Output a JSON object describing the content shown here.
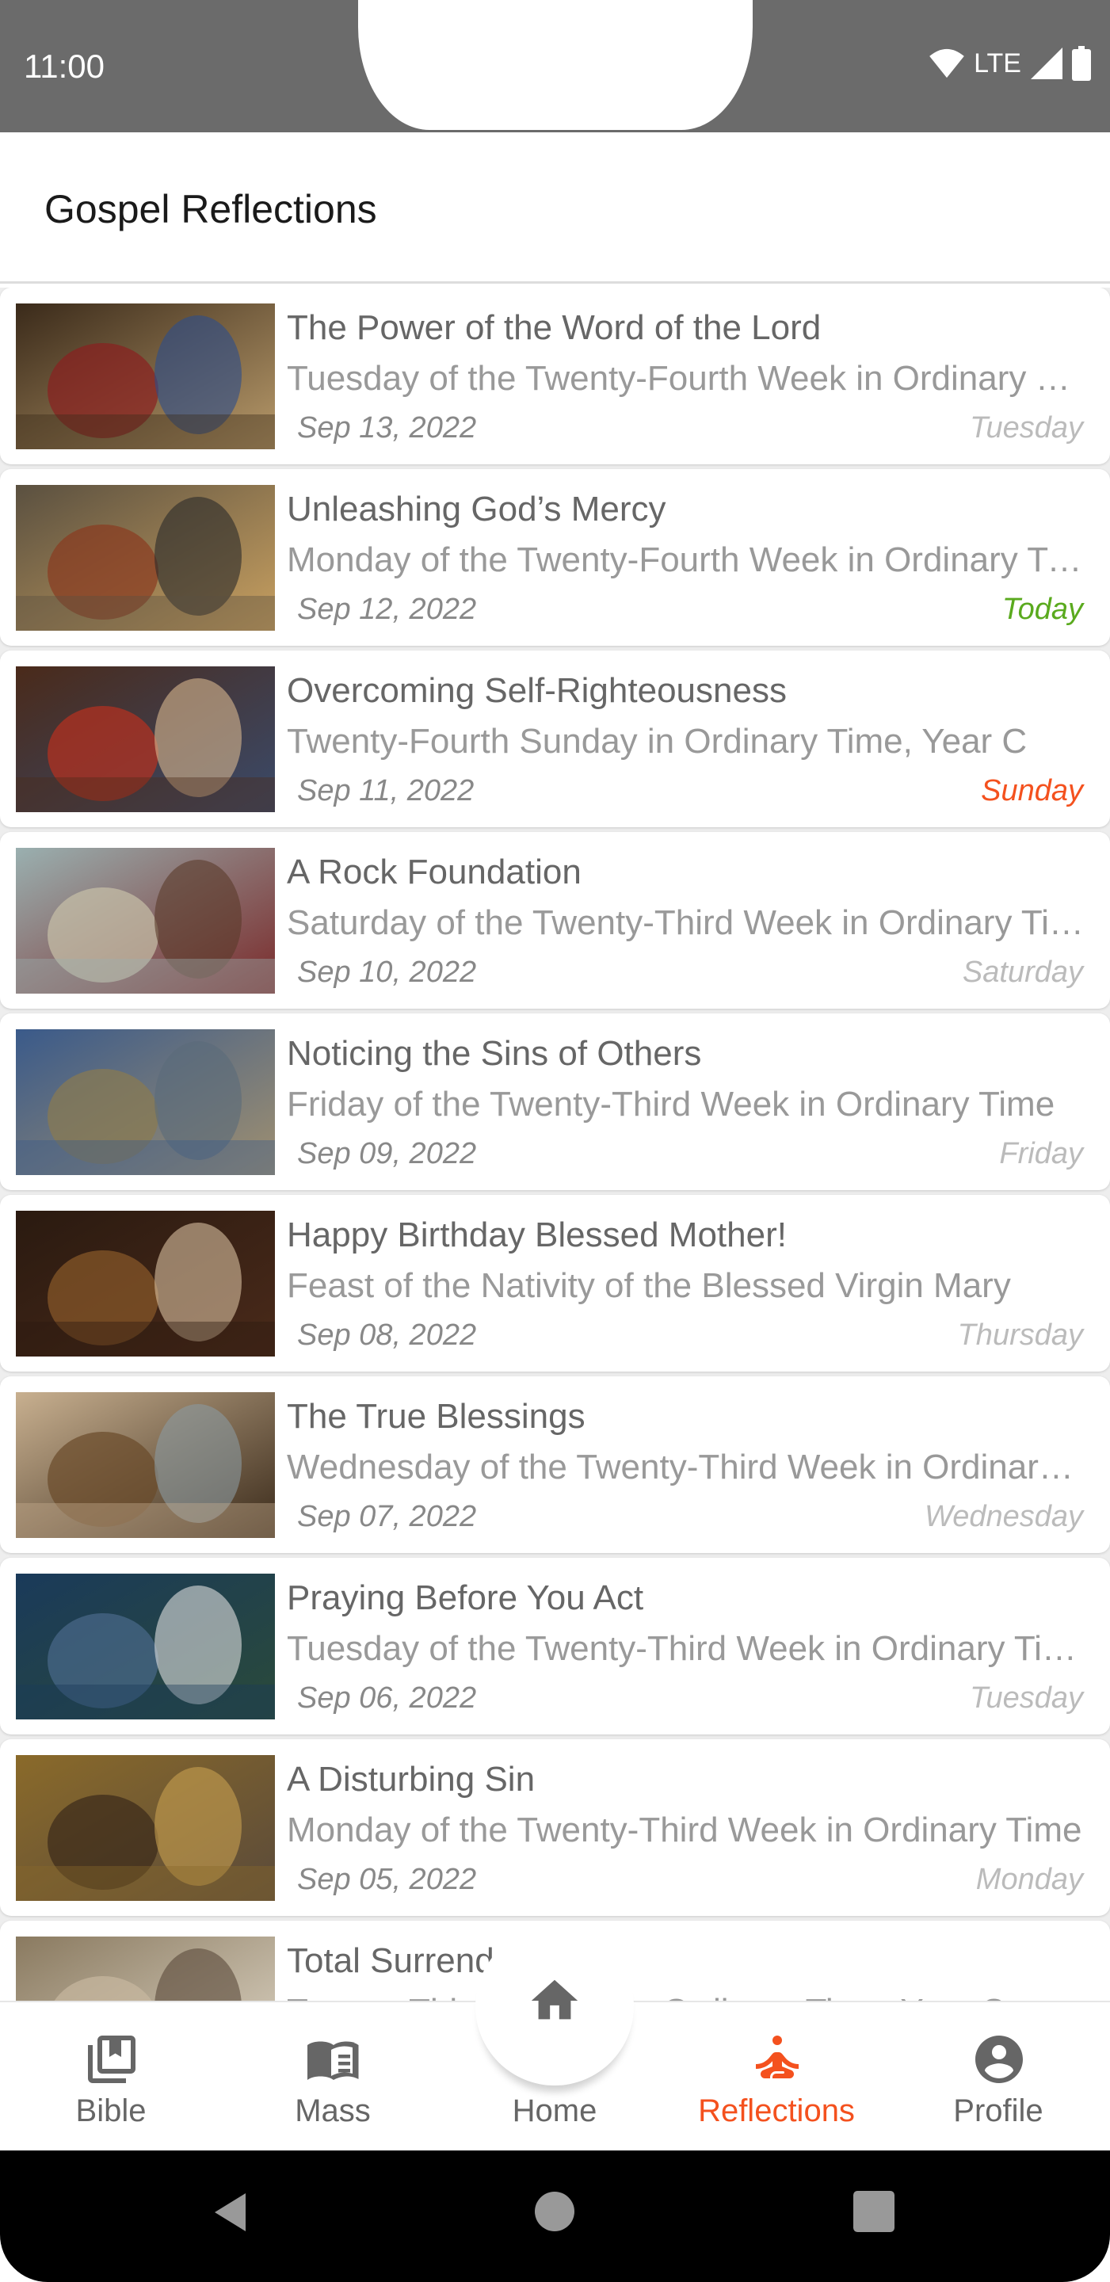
{
  "status_bar": {
    "time": "11:00",
    "network": "LTE",
    "icons": [
      "wifi-icon",
      "signal-icon",
      "battery-icon"
    ]
  },
  "header": {
    "title": "Gospel Reflections"
  },
  "colors": {
    "accent": "#f4511e",
    "today": "#5aaa1e",
    "sunday": "#f4511e",
    "weekday": "#bbbbbb",
    "status_bar": "#6b6b6b"
  },
  "reflections": [
    {
      "title": "The Power of the Word of the Lord",
      "subtitle": "Tuesday of the Twenty-Fourth Week in Ordinary Time",
      "date": "Sep 13, 2022",
      "day": "Tuesday",
      "day_type": "weekday",
      "thumb": [
        "#3a2a1a",
        "#8a2020",
        "#2c4c8c",
        "#b89a6a"
      ]
    },
    {
      "title": "Unleashing God’s Mercy",
      "subtitle": "Monday of the Twenty-Fourth Week in Ordinary Time",
      "date": "Sep 12, 2022",
      "day": "Today",
      "day_type": "today",
      "thumb": [
        "#5a5040",
        "#8a3a20",
        "#2a2a2a",
        "#c8a060"
      ]
    },
    {
      "title": "Overcoming Self-Righteousness",
      "subtitle": "Twenty-Fourth Sunday in Ordinary Time, Year C",
      "date": "Sep 11, 2022",
      "day": "Sunday",
      "day_type": "sunday",
      "thumb": [
        "#4a2a1a",
        "#b83020",
        "#d8b890",
        "#3a4a6a"
      ]
    },
    {
      "title": "A Rock Foundation",
      "subtitle": "Saturday of the Twenty-Third Week in Ordinary Time",
      "date": "Sep 10, 2022",
      "day": "Saturday",
      "day_type": "weekday",
      "thumb": [
        "#9ab0b0",
        "#c8c0a8",
        "#5a3a2a",
        "#7a2a2a"
      ]
    },
    {
      "title": "Noticing the Sins of Others",
      "subtitle": "Friday of the Twenty-Third Week in Ordinary Time",
      "date": "Sep 09, 2022",
      "day": "Friday",
      "day_type": "weekday",
      "thumb": [
        "#3a5a8a",
        "#8a7a50",
        "#5a6a7a",
        "#a09070"
      ]
    },
    {
      "title": "Happy Birthday Blessed Mother!",
      "subtitle": "Feast of the Nativity of the Blessed Virgin Mary",
      "date": "Sep 08, 2022",
      "day": "Thursday",
      "day_type": "weekday",
      "thumb": [
        "#2a1a10",
        "#8a5a2a",
        "#d8c0a0",
        "#4a2a1a"
      ]
    },
    {
      "title": "The True Blessings",
      "subtitle": "Wednesday of the Twenty-Third Week in Ordinary Time",
      "date": "Sep 07, 2022",
      "day": "Wednesday",
      "day_type": "weekday",
      "thumb": [
        "#c8b090",
        "#6a4a2a",
        "#8a9aa0",
        "#3a2a1a"
      ]
    },
    {
      "title": "Praying Before You Act",
      "subtitle": "Tuesday of the Twenty-Third Week in Ordinary Time",
      "date": "Sep 06, 2022",
      "day": "Tuesday",
      "day_type": "weekday",
      "thumb": [
        "#1a3a5a",
        "#4a6a8a",
        "#e0e0e0",
        "#2a4a3a"
      ]
    },
    {
      "title": "A Disturbing Sin",
      "subtitle": "Monday of the Twenty-Third Week in Ordinary Time",
      "date": "Sep 05, 2022",
      "day": "Monday",
      "day_type": "weekday",
      "thumb": [
        "#8a6a2a",
        "#3a2a1a",
        "#c8a050",
        "#5a4a3a"
      ]
    },
    {
      "title": "Total Surrender",
      "subtitle": "Twenty-Third Sunday in Ordinary Time, Year C",
      "date": "",
      "day": "",
      "day_type": "weekday",
      "thumb": [
        "#8a7a60",
        "#c8b8a0",
        "#5a4a3a",
        "#e0d8c8"
      ]
    }
  ],
  "bottom_nav": {
    "active": "Reflections",
    "items": [
      {
        "label": "Bible",
        "icon": "bible-icon"
      },
      {
        "label": "Mass",
        "icon": "book-icon"
      },
      {
        "label": "Home",
        "icon": "home-icon"
      },
      {
        "label": "Reflections",
        "icon": "meditation-icon"
      },
      {
        "label": "Profile",
        "icon": "profile-icon"
      }
    ]
  },
  "system_nav": {
    "buttons": [
      "back",
      "home",
      "recents"
    ]
  }
}
